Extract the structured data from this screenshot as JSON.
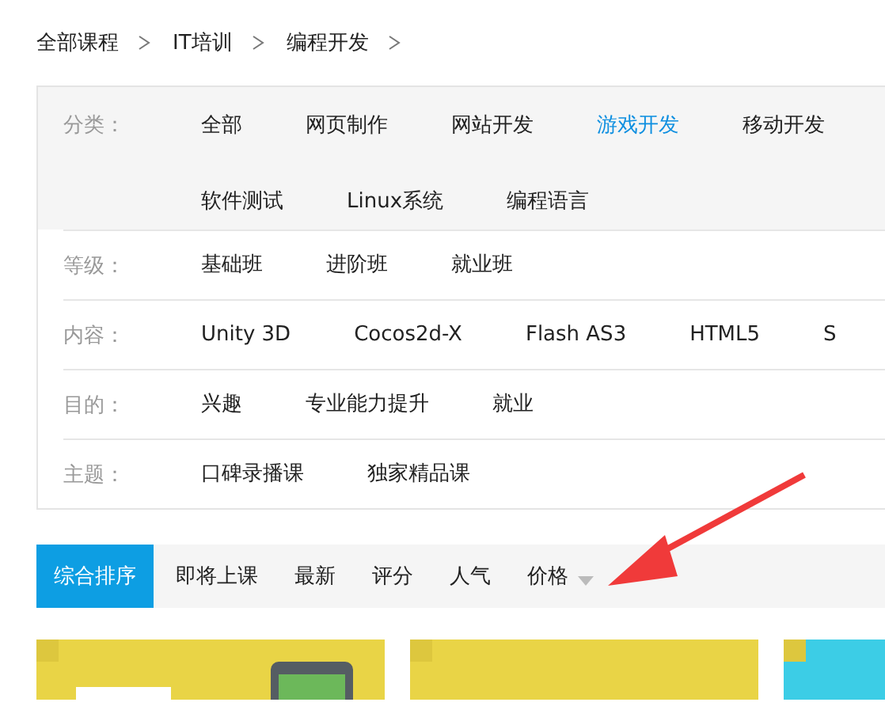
{
  "breadcrumb": [
    "全部课程",
    "IT培训",
    "编程开发"
  ],
  "filters": [
    {
      "label": "分类：",
      "kind": "shaded",
      "items": [
        {
          "text": "全部",
          "selected": false
        },
        {
          "text": "网页制作",
          "selected": false
        },
        {
          "text": "网站开发",
          "selected": false
        },
        {
          "text": "游戏开发",
          "selected": true
        },
        {
          "text": "移动开发",
          "selected": false
        },
        {
          "text": "软件测试",
          "selected": false
        },
        {
          "text": "Linux系统",
          "selected": false
        },
        {
          "text": "编程语言",
          "selected": false
        }
      ]
    },
    {
      "label": "等级：",
      "kind": "plain",
      "items": [
        {
          "text": "基础班",
          "selected": false
        },
        {
          "text": "进阶班",
          "selected": false
        },
        {
          "text": "就业班",
          "selected": false
        }
      ]
    },
    {
      "label": "内容：",
      "kind": "plain",
      "items": [
        {
          "text": "Unity 3D",
          "selected": false
        },
        {
          "text": "Cocos2d-X",
          "selected": false
        },
        {
          "text": "Flash AS3",
          "selected": false
        },
        {
          "text": "HTML5",
          "selected": false
        },
        {
          "text": "S",
          "selected": false
        }
      ]
    },
    {
      "label": "目的：",
      "kind": "plain",
      "items": [
        {
          "text": "兴趣",
          "selected": false
        },
        {
          "text": "专业能力提升",
          "selected": false
        },
        {
          "text": "就业",
          "selected": false
        }
      ]
    },
    {
      "label": "主题：",
      "kind": "plain",
      "items": [
        {
          "text": "口碑录播课",
          "selected": false
        },
        {
          "text": "独家精品课",
          "selected": false
        }
      ]
    }
  ],
  "sort_tabs": [
    {
      "label": "综合排序",
      "selected": true
    },
    {
      "label": "即将上课",
      "selected": false
    },
    {
      "label": "最新",
      "selected": false
    },
    {
      "label": "评分",
      "selected": false
    },
    {
      "label": "人气",
      "selected": false
    },
    {
      "label": "价格",
      "selected": false,
      "kind": "dropdown"
    }
  ]
}
